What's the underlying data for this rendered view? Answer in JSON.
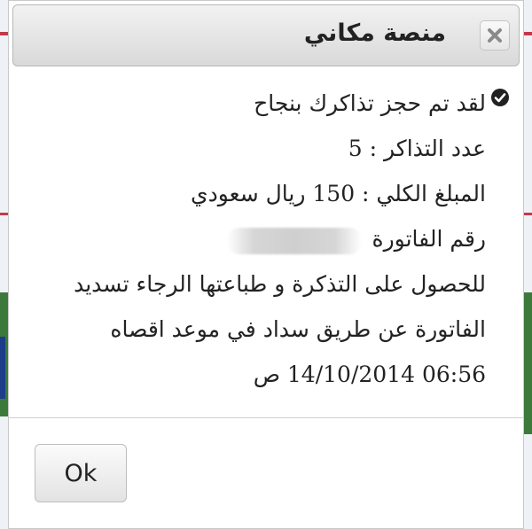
{
  "dialog": {
    "title": "منصة مكاني",
    "close_icon": "close-icon",
    "message": {
      "status_icon": "check-circle-icon",
      "line1": "لقد تم حجز تذاكرك بنجاح",
      "ticket_count": "عدد التذاكر : 5",
      "total_amount": "المبلغ الكلي : 150 ريال سعودي",
      "invoice_label": "رقم الفاتورة",
      "instruction_line1": "للحصول على التذكرة و طباعتها الرجاء تسديد",
      "instruction_line2": "الفاتورة عن طريق سداد في موعد اقصاه",
      "deadline": "06:56 14/10/2014 ص"
    },
    "ok_label": "Ok"
  }
}
